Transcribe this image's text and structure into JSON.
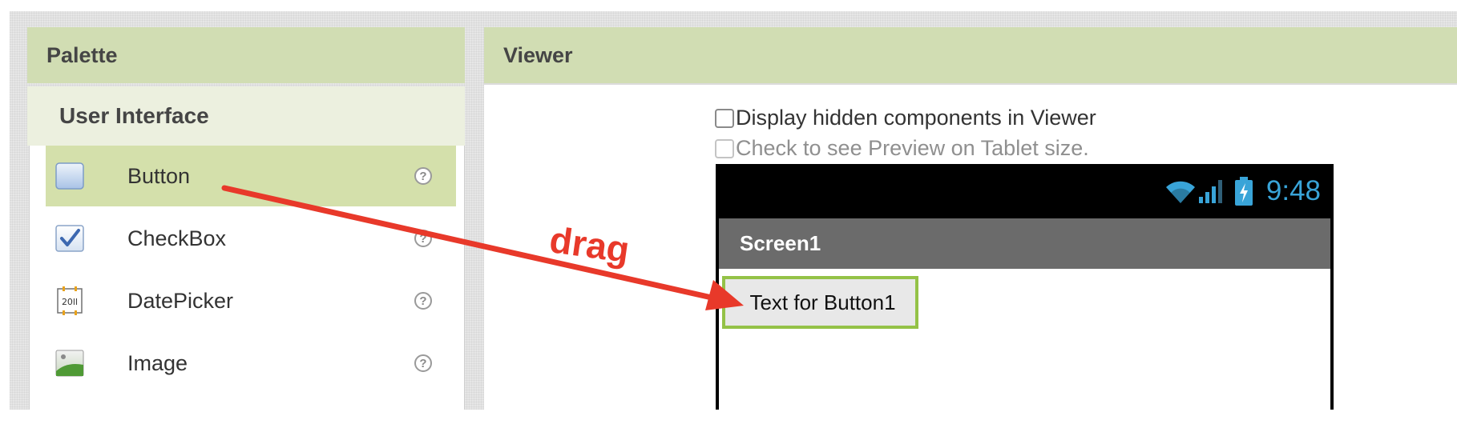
{
  "palette": {
    "title": "Palette",
    "category": "User Interface",
    "items": [
      {
        "label": "Button",
        "icon": "button-icon",
        "selected": true
      },
      {
        "label": "CheckBox",
        "icon": "checkbox-icon",
        "selected": false
      },
      {
        "label": "DatePicker",
        "icon": "datepicker-icon",
        "selected": false
      },
      {
        "label": "Image",
        "icon": "image-icon",
        "selected": false
      }
    ],
    "help_glyph": "?"
  },
  "viewer": {
    "title": "Viewer",
    "display_hidden_label": "Display hidden components in Viewer",
    "tablet_preview_label": "Check to see Preview on Tablet size."
  },
  "phone": {
    "status_time": "9:48",
    "screen_title": "Screen1",
    "button_text": "Text for Button1"
  },
  "annotation": {
    "drag_label": "drag"
  },
  "colors": {
    "header_green": "#d1ddb3",
    "selected_green": "#d4e0ab",
    "arrow_red": "#e8392a",
    "status_blue": "#39a4d8",
    "button_border_green": "#94c247"
  }
}
